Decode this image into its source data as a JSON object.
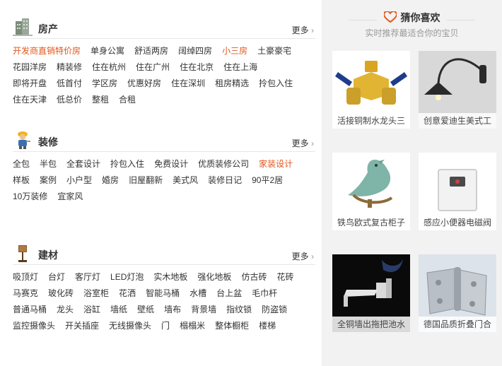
{
  "sections": [
    {
      "title": "房产",
      "more": "更多",
      "icon": "building-icon",
      "links": [
        "开发商直销特价房",
        "单身公寓",
        "舒适两房",
        "阔绰四房",
        "小三房",
        "土豪豪宅",
        "花园洋房",
        "精装修",
        "住在杭州",
        "住在广州",
        "住在北京",
        "住在上海",
        "即将开盘",
        "低首付",
        "学区房",
        "优惠好房",
        "住在深圳",
        "租房精选",
        "拎包入住",
        "住在天津",
        "低总价",
        "整租",
        "合租"
      ],
      "hot": [
        0,
        4
      ]
    },
    {
      "title": "装修",
      "more": "更多",
      "icon": "worker-icon",
      "links": [
        "全包",
        "半包",
        "全套设计",
        "拎包入住",
        "免费设计",
        "优质装修公司",
        "家装设计",
        "样板",
        "案例",
        "小户型",
        "婚房",
        "旧屋翻新",
        "美式风",
        "装修日记",
        "90平2居",
        "10万装修",
        "宜家风"
      ],
      "hot": [
        6
      ]
    },
    {
      "title": "建材",
      "more": "更多",
      "icon": "lamp-icon",
      "links": [
        "吸顶灯",
        "台灯",
        "客厅灯",
        "LED灯泡",
        "实木地板",
        "强化地板",
        "仿古砖",
        "花砖",
        "马赛克",
        "玻化砖",
        "浴室柜",
        "花洒",
        "智能马桶",
        "水槽",
        "台上盆",
        "毛巾杆",
        "普通马桶",
        "龙头",
        "浴缸",
        "墙纸",
        "壁纸",
        "墙布",
        "背景墙",
        "指纹锁",
        "防盗锁",
        "监控摄像头",
        "开关插座",
        "无线摄像头",
        "门",
        "榻榻米",
        "整体橱柜",
        "楼梯"
      ],
      "hot": []
    }
  ],
  "guess": {
    "title": "猜你喜欢",
    "subtitle": "实时推荐最适合你的宝贝",
    "products": [
      {
        "caption": "活接铜制水龙头三",
        "icon": "brass-valve-icon"
      },
      {
        "caption": "创意爱迪生美式工",
        "icon": "wall-lamp-icon"
      },
      {
        "caption": "铁鸟欧式复古柜子",
        "icon": "bird-ornament-icon"
      },
      {
        "caption": "感应小便器电磁阀",
        "icon": "sensor-panel-icon"
      },
      {
        "caption": "全铜墙出拖把池水",
        "icon": "wall-faucet-icon"
      },
      {
        "caption": "德国品质折叠门合",
        "icon": "hinge-icon"
      }
    ]
  },
  "colors": {
    "hot": "#e4561b",
    "heart": "#e4561b"
  }
}
